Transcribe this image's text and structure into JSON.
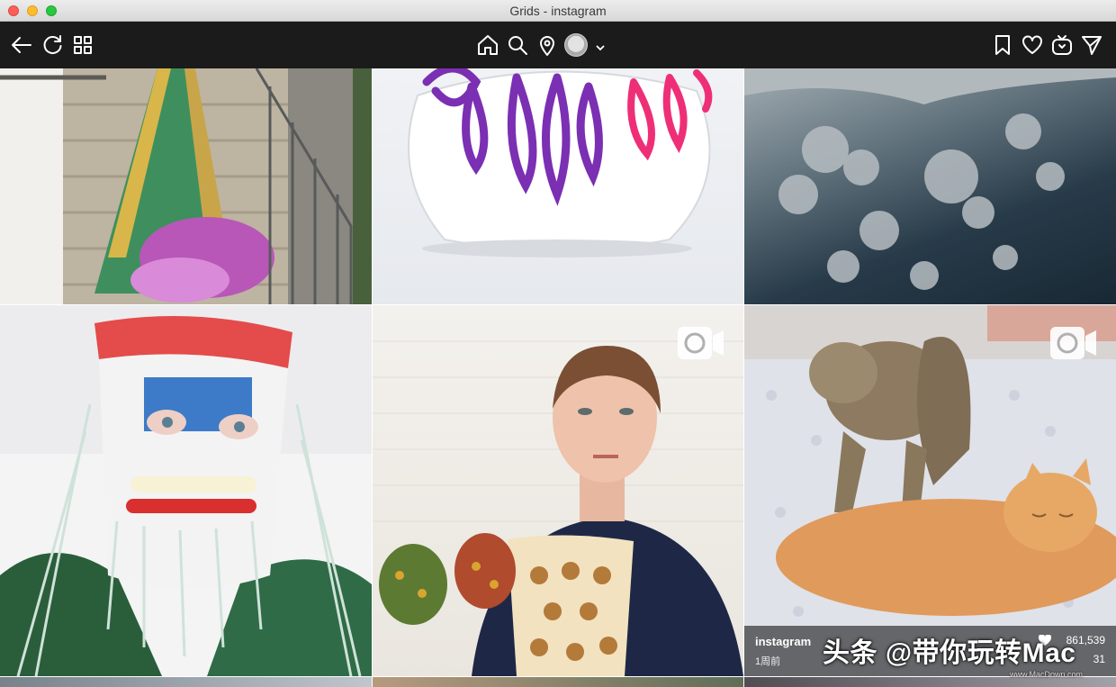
{
  "window": {
    "title": "Grids - instagram"
  },
  "toolbar": {
    "left_icons": [
      "back-arrow-icon",
      "refresh-icon",
      "grid-icon"
    ],
    "center_icons": [
      "home-icon",
      "search-icon",
      "location-pin-icon"
    ],
    "right_icons": [
      "bookmark-icon",
      "heart-icon",
      "igtv-icon",
      "direct-message-icon"
    ]
  },
  "grid": {
    "tiles": [
      {
        "has_video": false
      },
      {
        "has_video": false
      },
      {
        "has_video": false
      },
      {
        "has_video": false
      },
      {
        "has_video": true,
        "badge_icon": "video-camera-icon"
      },
      {
        "has_video": true,
        "badge_icon": "video-camera-icon",
        "caption": {
          "username": "instagram",
          "time_ago": "1周前",
          "likes": "861,539",
          "comments": "31"
        }
      }
    ]
  },
  "watermark": {
    "text": "头条 @带你玩转Mac",
    "sub_text": "www.MacDown.com"
  },
  "colors": {
    "toolbar_bg": "#1b1b1b",
    "icon": "#ffffff",
    "overlay": "rgba(0,0,0,0.55)"
  }
}
